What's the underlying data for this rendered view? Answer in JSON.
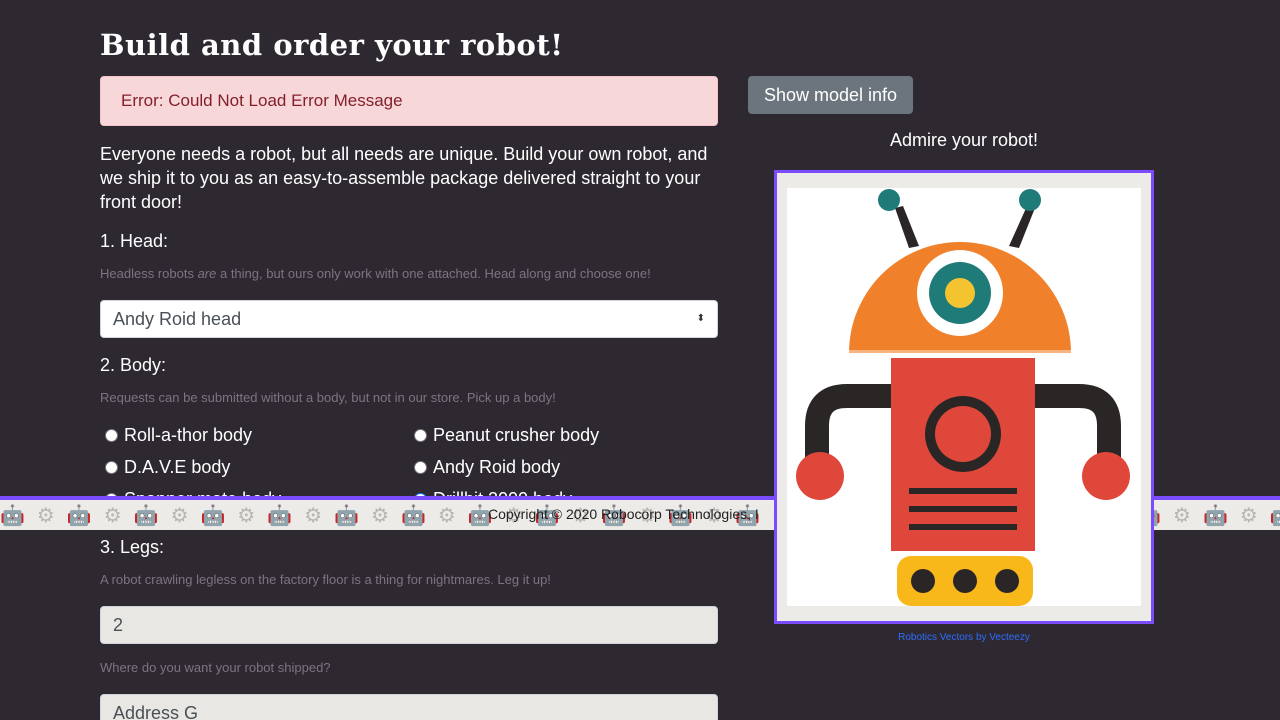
{
  "page": {
    "title": "Build and order your robot!",
    "error": "Error: Could Not Load Error Message",
    "intro": "Everyone needs a robot, but all needs are unique. Build your own robot, and we ship it to you as an easy-to-assemble package delivered straight to your front door!"
  },
  "head": {
    "label": "1. Head:",
    "help_before": "Headless robots ",
    "help_em": "are",
    "help_after": " a thing, but ours only work with one attached. Head along and choose one!",
    "selected": "Andy Roid head"
  },
  "body": {
    "label": "2. Body:",
    "help": "Requests can be submitted without a body, but not in our store. Pick up a body!",
    "options": [
      {
        "label": "Roll-a-thor body",
        "checked": false
      },
      {
        "label": "Peanut crusher body",
        "checked": false
      },
      {
        "label": "D.A.V.E body",
        "checked": false
      },
      {
        "label": "Andy Roid body",
        "checked": false
      },
      {
        "label": "Spanner mate body",
        "checked": false
      },
      {
        "label": "Drillbit 2000 body",
        "checked": true
      }
    ]
  },
  "legs": {
    "label": "3. Legs:",
    "help": "A robot crawling legless on the factory floor is a thing for nightmares. Leg it up!",
    "value": "2"
  },
  "address": {
    "help": "Where do you want your robot shipped?",
    "value": "Address G"
  },
  "footer": {
    "text": "Copyright © 2020 Robocorp Technologies, I"
  },
  "preview": {
    "button": "Show model info",
    "caption": "Admire your robot!",
    "credit": "Robotics Vectors by Vecteezy"
  },
  "colors": {
    "accent": "#7b4cff",
    "head_orange": "#f0802a",
    "body_red": "#e0473b",
    "teal": "#1f7b77",
    "yellow": "#f9b81a"
  }
}
